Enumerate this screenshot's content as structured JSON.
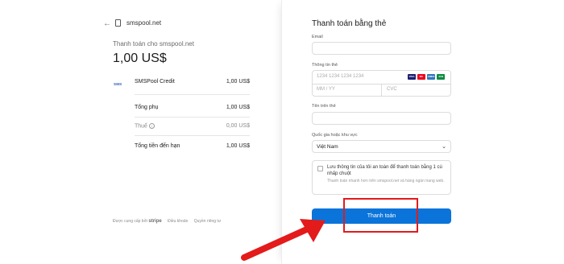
{
  "summary": {
    "back_icon": "arrow-left-icon",
    "merchant_icon": "document-icon",
    "merchant_name": "smspool.net",
    "pay_to_label": "Thanh toán cho smspool.net",
    "total_amount": "1,00 US$",
    "item_logo_text": "SMS",
    "line_item_name": "SMSPool Credit",
    "line_item_price": "1,00 US$",
    "subtotal_label": "Tổng phụ",
    "subtotal_value": "1,00 US$",
    "tax_label": "Thuế",
    "tax_value": "0,00 US$",
    "total_due_label": "Tổng tiền đến hạn",
    "total_due_value": "1,00 US$"
  },
  "footer": {
    "powered_by": "Được cung cấp bởi",
    "brand": "stripe",
    "terms_link": "Điều khoản",
    "privacy_link": "Quyền riêng tư"
  },
  "form": {
    "title": "Thanh toán bằng thẻ",
    "email_label": "Email",
    "email_value": "",
    "card_label": "Thông tin thẻ",
    "card_number_placeholder": "1234 1234 1234 1234",
    "expiry_placeholder": "MM / YY",
    "cvc_placeholder": "CVC",
    "card_brands": [
      "VISA",
      "MC",
      "AMEX",
      "JCB"
    ],
    "name_label": "Tên trên thẻ",
    "name_value": "",
    "country_label": "Quốc gia hoặc khu vực",
    "country_value": "Việt Nam",
    "save_title": "Lưu thông tin của tôi an toàn để thanh toán bằng 1 cú nhấp chuột",
    "save_desc": "Thanh toán nhanh hơn trên smspool.net và hàng ngàn trang web.",
    "save_checked": false,
    "pay_button": "Thanh toán"
  },
  "colors": {
    "accent": "#0a74da",
    "highlight": "#e31b1b"
  }
}
